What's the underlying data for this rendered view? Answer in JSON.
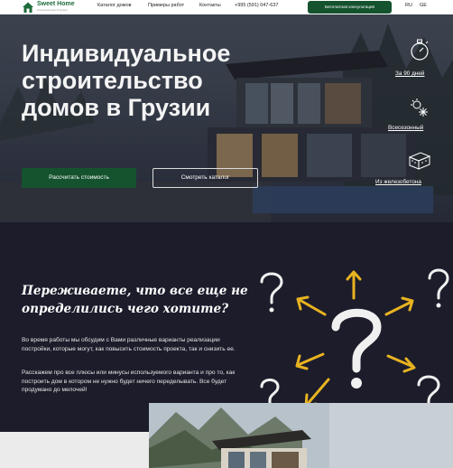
{
  "header": {
    "logo_title": "Sweet Home",
    "logo_subtitle": "Строительство в Грузии",
    "nav": [
      "Каталог домов",
      "Примеры работ",
      "Контакты"
    ],
    "phone": "+995 (591) 047-637",
    "cta_label": "Бесплатная консультация",
    "languages": [
      "RU",
      "GE"
    ],
    "brand_color": "#15532f"
  },
  "hero": {
    "title": "Индивидуальное строительство домов в Грузии",
    "button_calc": "Рассчитать стоимость",
    "button_catalog": "Смотреть каталог",
    "features": [
      {
        "icon": "stopwatch-icon",
        "label": "За 90 дней"
      },
      {
        "icon": "snowflake-sun-icon",
        "label": "Всесезонный"
      },
      {
        "icon": "concrete-block-icon",
        "label": "Из железобетона"
      }
    ]
  },
  "section2": {
    "title": "Переживаете, что все еще не определились чего хотите?",
    "paragraph1": "Во время работы мы обсудим с Вами различные варианты реализации постройки, которые могут, как повысить стоимость проекта, так и снизить ее.",
    "paragraph2": "Расскажем про все плюсы или минусы используемого варианта и про то, как построить дом в котором не нужно будет ничего переделывать. Все будет продумано до мелочей!",
    "accent_color": "#e8b320"
  }
}
